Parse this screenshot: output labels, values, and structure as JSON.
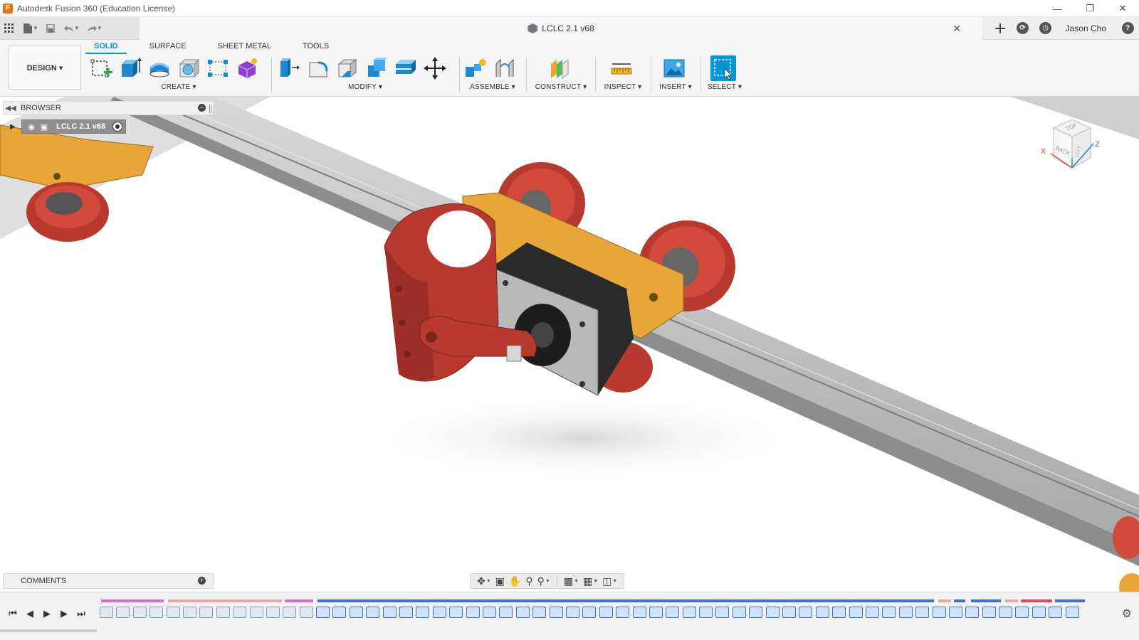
{
  "window": {
    "title": "Autodesk Fusion 360 (Education License)",
    "app_icon": "F",
    "controls": [
      "minimize-icon",
      "restore-icon",
      "close-icon"
    ]
  },
  "appbar": {
    "left_icons": [
      "grid-icon",
      "file-icon",
      "save-icon",
      "undo-icon",
      "redo-icon"
    ],
    "document_title": "LCLC 2.1 v68",
    "user_name": "Jason Cho",
    "help_glyph": "?"
  },
  "toolbar": {
    "workspace": "DESIGN ▾",
    "tabs": [
      {
        "label": "SOLID",
        "active": true
      },
      {
        "label": "SURFACE",
        "active": false
      },
      {
        "label": "SHEET METAL",
        "active": false
      },
      {
        "label": "TOOLS",
        "active": false
      }
    ],
    "groups": [
      {
        "label": "CREATE ▾",
        "tools": [
          "create-sketch-icon",
          "extrude-icon",
          "revolve-icon",
          "hole-icon",
          "rectangular-pattern-icon",
          "create-form-icon"
        ]
      },
      {
        "label": "MODIFY ▾",
        "tools": [
          "press-pull-icon",
          "fillet-icon",
          "chamfer-icon",
          "combine-icon",
          "shell-icon",
          "move-icon"
        ]
      },
      {
        "label": "ASSEMBLE ▾",
        "tools": [
          "new-component-icon",
          "joint-icon"
        ]
      },
      {
        "label": "CONSTRUCT ▾",
        "tools": [
          "offset-plane-icon"
        ]
      },
      {
        "label": "INSPECT ▾",
        "tools": [
          "measure-icon"
        ]
      },
      {
        "label": "INSERT ▾",
        "tools": [
          "insert-image-icon"
        ]
      },
      {
        "label": "SELECT ▾",
        "tools": [
          "select-icon"
        ]
      }
    ]
  },
  "browser": {
    "title": "BROWSER",
    "root_label": "LCLC 2.1 v68"
  },
  "viewcube": {
    "faces": [
      "TOP",
      "BACK",
      "LEFT"
    ],
    "axes": [
      "X",
      "Z"
    ]
  },
  "comments": {
    "title": "COMMENTS"
  },
  "navbar": {
    "buttons": [
      "orbit-icon",
      "look-at-icon",
      "pan-icon",
      "zoom-icon",
      "fit-icon",
      "display-settings-icon",
      "grid-settings-icon",
      "viewports-icon"
    ]
  },
  "timeline": {
    "controls": [
      "skip-to-start-icon",
      "step-back-icon",
      "play-icon",
      "step-forward-icon",
      "skip-to-end-icon"
    ],
    "item_count": 59
  },
  "colors": {
    "accent": "#0696d7",
    "part_orange": "#e8a53a",
    "part_red": "#b83a2f",
    "rail_gray": "#b7b7b7",
    "motor_dark": "#2a2a2a"
  }
}
